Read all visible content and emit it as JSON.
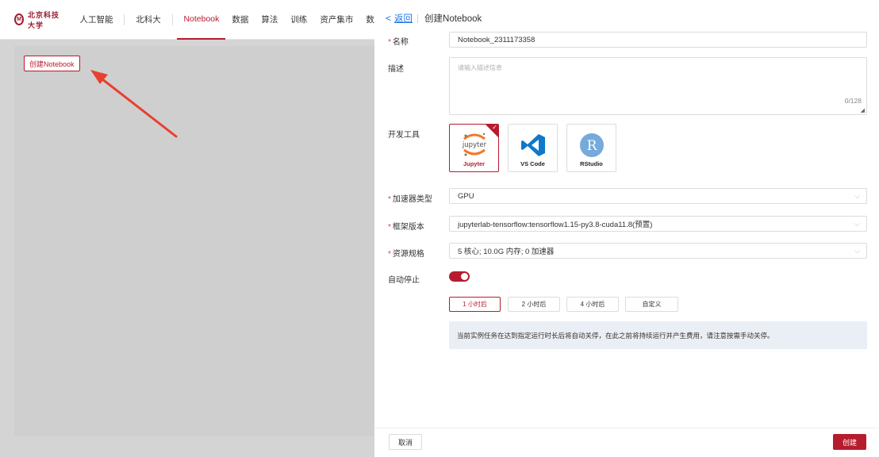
{
  "nav": {
    "logo_mark": "M",
    "logo_text": "北京科技大学",
    "items": [
      "人工智能",
      "北科大",
      "Notebook",
      "数据",
      "算法",
      "训练",
      "资产集市",
      "数"
    ]
  },
  "content": {
    "create_button": "创建Notebook"
  },
  "drawer": {
    "back_chevron": "<",
    "back_label": "返回",
    "title": "创建Notebook",
    "required_mark": "*",
    "name": {
      "label": "名称",
      "value": "Notebook_2311173358"
    },
    "description": {
      "label": "描述",
      "placeholder": "请输入描述信息",
      "counter": "0/128"
    },
    "tools": {
      "label": "开发工具",
      "options": [
        {
          "name": "Jupyter",
          "icon": "jupyter-logo",
          "selected": true
        },
        {
          "name": "VS Code",
          "icon": "vscode-logo",
          "selected": false
        },
        {
          "name": "RStudio",
          "icon": "rstudio-logo",
          "selected": false
        }
      ],
      "jupyter_logo_text": "jupyter",
      "rstudio_logo_text": "R",
      "check": "✓"
    },
    "accelerator": {
      "label": "加速器类型",
      "value": "GPU"
    },
    "framework": {
      "label": "框架版本",
      "value": "jupyterlab-tensorflow:tensorflow1.15-py3.8-cuda11.8(预置)"
    },
    "resources": {
      "label": "资源规格",
      "value": "5 核心; 10.0G 内存; 0 加速器"
    },
    "auto_stop": {
      "label": "自动停止",
      "enabled": true,
      "options": [
        "1 小时后",
        "2 小时后",
        "4 小时后",
        "自定义"
      ],
      "selected": "1 小时后"
    },
    "notice": "当前实例任务在达到指定运行时长后将自动关停，在此之前将持续运行并产生费用，请注意按需手动关停。",
    "cancel_label": "取消",
    "submit_label": "创建",
    "select_chevron": "⌵"
  },
  "colors": {
    "brand": "#b61c2e",
    "link": "#1a73e8",
    "notice_bg": "#eaeef5"
  }
}
